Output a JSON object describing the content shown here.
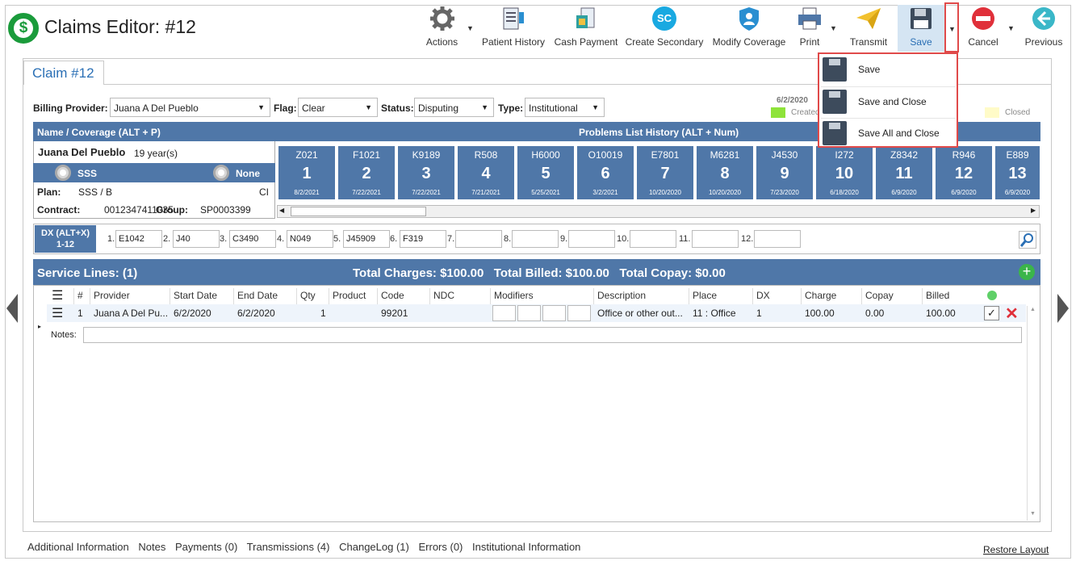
{
  "app": {
    "title": "Claims Editor: #12",
    "logo_symbol": "$"
  },
  "toolbar": [
    {
      "label": "Actions",
      "icon": "gear-icon"
    },
    {
      "label": "Patient History",
      "icon": "history-icon"
    },
    {
      "label": "Cash Payment",
      "icon": "cash-icon"
    },
    {
      "label": "Create Secondary",
      "icon": "sc-icon",
      "icon_text": "SC"
    },
    {
      "label": "Modify Coverage",
      "icon": "shield-user-icon"
    },
    {
      "label": "Print",
      "icon": "printer-icon"
    },
    {
      "label": "Transmit",
      "icon": "paper-plane-icon"
    },
    {
      "label": "Save",
      "icon": "floppy-icon"
    },
    {
      "label": "Cancel",
      "icon": "cancel-icon"
    },
    {
      "label": "Previous",
      "icon": "arrow-left-icon"
    }
  ],
  "save_menu": [
    "Save",
    "Save and Close",
    "Save All and Close"
  ],
  "tab": {
    "label": "Claim #12"
  },
  "fields": {
    "billing_provider_label": "Billing Provider:",
    "billing_provider": "Juana A Del Pueblo",
    "flag_label": "Flag:",
    "flag": "Clear",
    "status_label": "Status:",
    "status": "Disputing",
    "type_label": "Type:",
    "type": "Institutional"
  },
  "legend": {
    "date": "6/2/2020",
    "created": "Created",
    "closed": "Closed",
    "created_color": "#8ee33a",
    "closed_color": "#fffbc8"
  },
  "patient": {
    "header": "Name / Coverage (ALT + P)",
    "name": "Juana Del Pueblo",
    "age": "19 year(s)",
    "coverage1": "SSS",
    "coverage2": "None",
    "plan_label": "Plan:",
    "plan": "SSS  /  B",
    "plan_code": "CI",
    "contract_label": "Contract:",
    "contract": "0012347411035",
    "group_label": "Group:",
    "group": "SP0003399"
  },
  "problems": {
    "header": "Problems List History (ALT + Num)",
    "items": [
      {
        "code": "Z021",
        "num": "1",
        "date": "8/2/2021"
      },
      {
        "code": "F1021",
        "num": "2",
        "date": "7/22/2021"
      },
      {
        "code": "K9189",
        "num": "3",
        "date": "7/22/2021"
      },
      {
        "code": "R508",
        "num": "4",
        "date": "7/21/2021"
      },
      {
        "code": "H6000",
        "num": "5",
        "date": "5/25/2021"
      },
      {
        "code": "O10019",
        "num": "6",
        "date": "3/2/2021"
      },
      {
        "code": "E7801",
        "num": "7",
        "date": "10/20/2020"
      },
      {
        "code": "M6281",
        "num": "8",
        "date": "10/20/2020"
      },
      {
        "code": "J4530",
        "num": "9",
        "date": "7/23/2020"
      },
      {
        "code": "I272",
        "num": "10",
        "date": "6/18/2020"
      },
      {
        "code": "Z8342",
        "num": "11",
        "date": "6/9/2020"
      },
      {
        "code": "R946",
        "num": "12",
        "date": "6/9/2020"
      },
      {
        "code": "E889",
        "num": "13",
        "date": "6/9/2020"
      }
    ]
  },
  "dx": {
    "label": "DX (ALT+X)",
    "range": "1-12",
    "items": [
      {
        "n": "1.",
        "v": "E1042"
      },
      {
        "n": "2.",
        "v": "J40"
      },
      {
        "n": "3.",
        "v": "C3490"
      },
      {
        "n": "4.",
        "v": "N049"
      },
      {
        "n": "5.",
        "v": "J45909"
      },
      {
        "n": "6.",
        "v": "F319"
      },
      {
        "n": "7.",
        "v": ""
      },
      {
        "n": "8.",
        "v": ""
      },
      {
        "n": "9.",
        "v": ""
      },
      {
        "n": "10.",
        "v": ""
      },
      {
        "n": "11.",
        "v": ""
      },
      {
        "n": "12.",
        "v": ""
      }
    ]
  },
  "service": {
    "title": "Service Lines: (1)",
    "totals": "Total Charges: $100.00   Total Billed: $100.00   Total Copay: $0.00",
    "columns": [
      "#",
      "Provider",
      "Start Date",
      "End Date",
      "Qty",
      "Product",
      "Code",
      "NDC",
      "Modifiers",
      "Description",
      "Place",
      "DX",
      "Charge",
      "Copay",
      "Billed"
    ],
    "row": {
      "num": "1",
      "provider": "Juana A Del Pu...",
      "start": "6/2/2020",
      "end": "6/2/2020",
      "qty": "1",
      "product": "",
      "code": "99201",
      "ndc": "",
      "description": "Office or other out...",
      "place": "11 : Office",
      "dx": "1",
      "charge": "100.00",
      "copay": "0.00",
      "billed": "100.00"
    },
    "notes_label": "Notes:"
  },
  "bottom_tabs": [
    "Additional Information",
    "Notes",
    "Payments (0)",
    "Transmissions (4)",
    "ChangeLog (1)",
    "Errors (0)",
    "Institutional Information"
  ],
  "restore_layout": "Restore Layout"
}
